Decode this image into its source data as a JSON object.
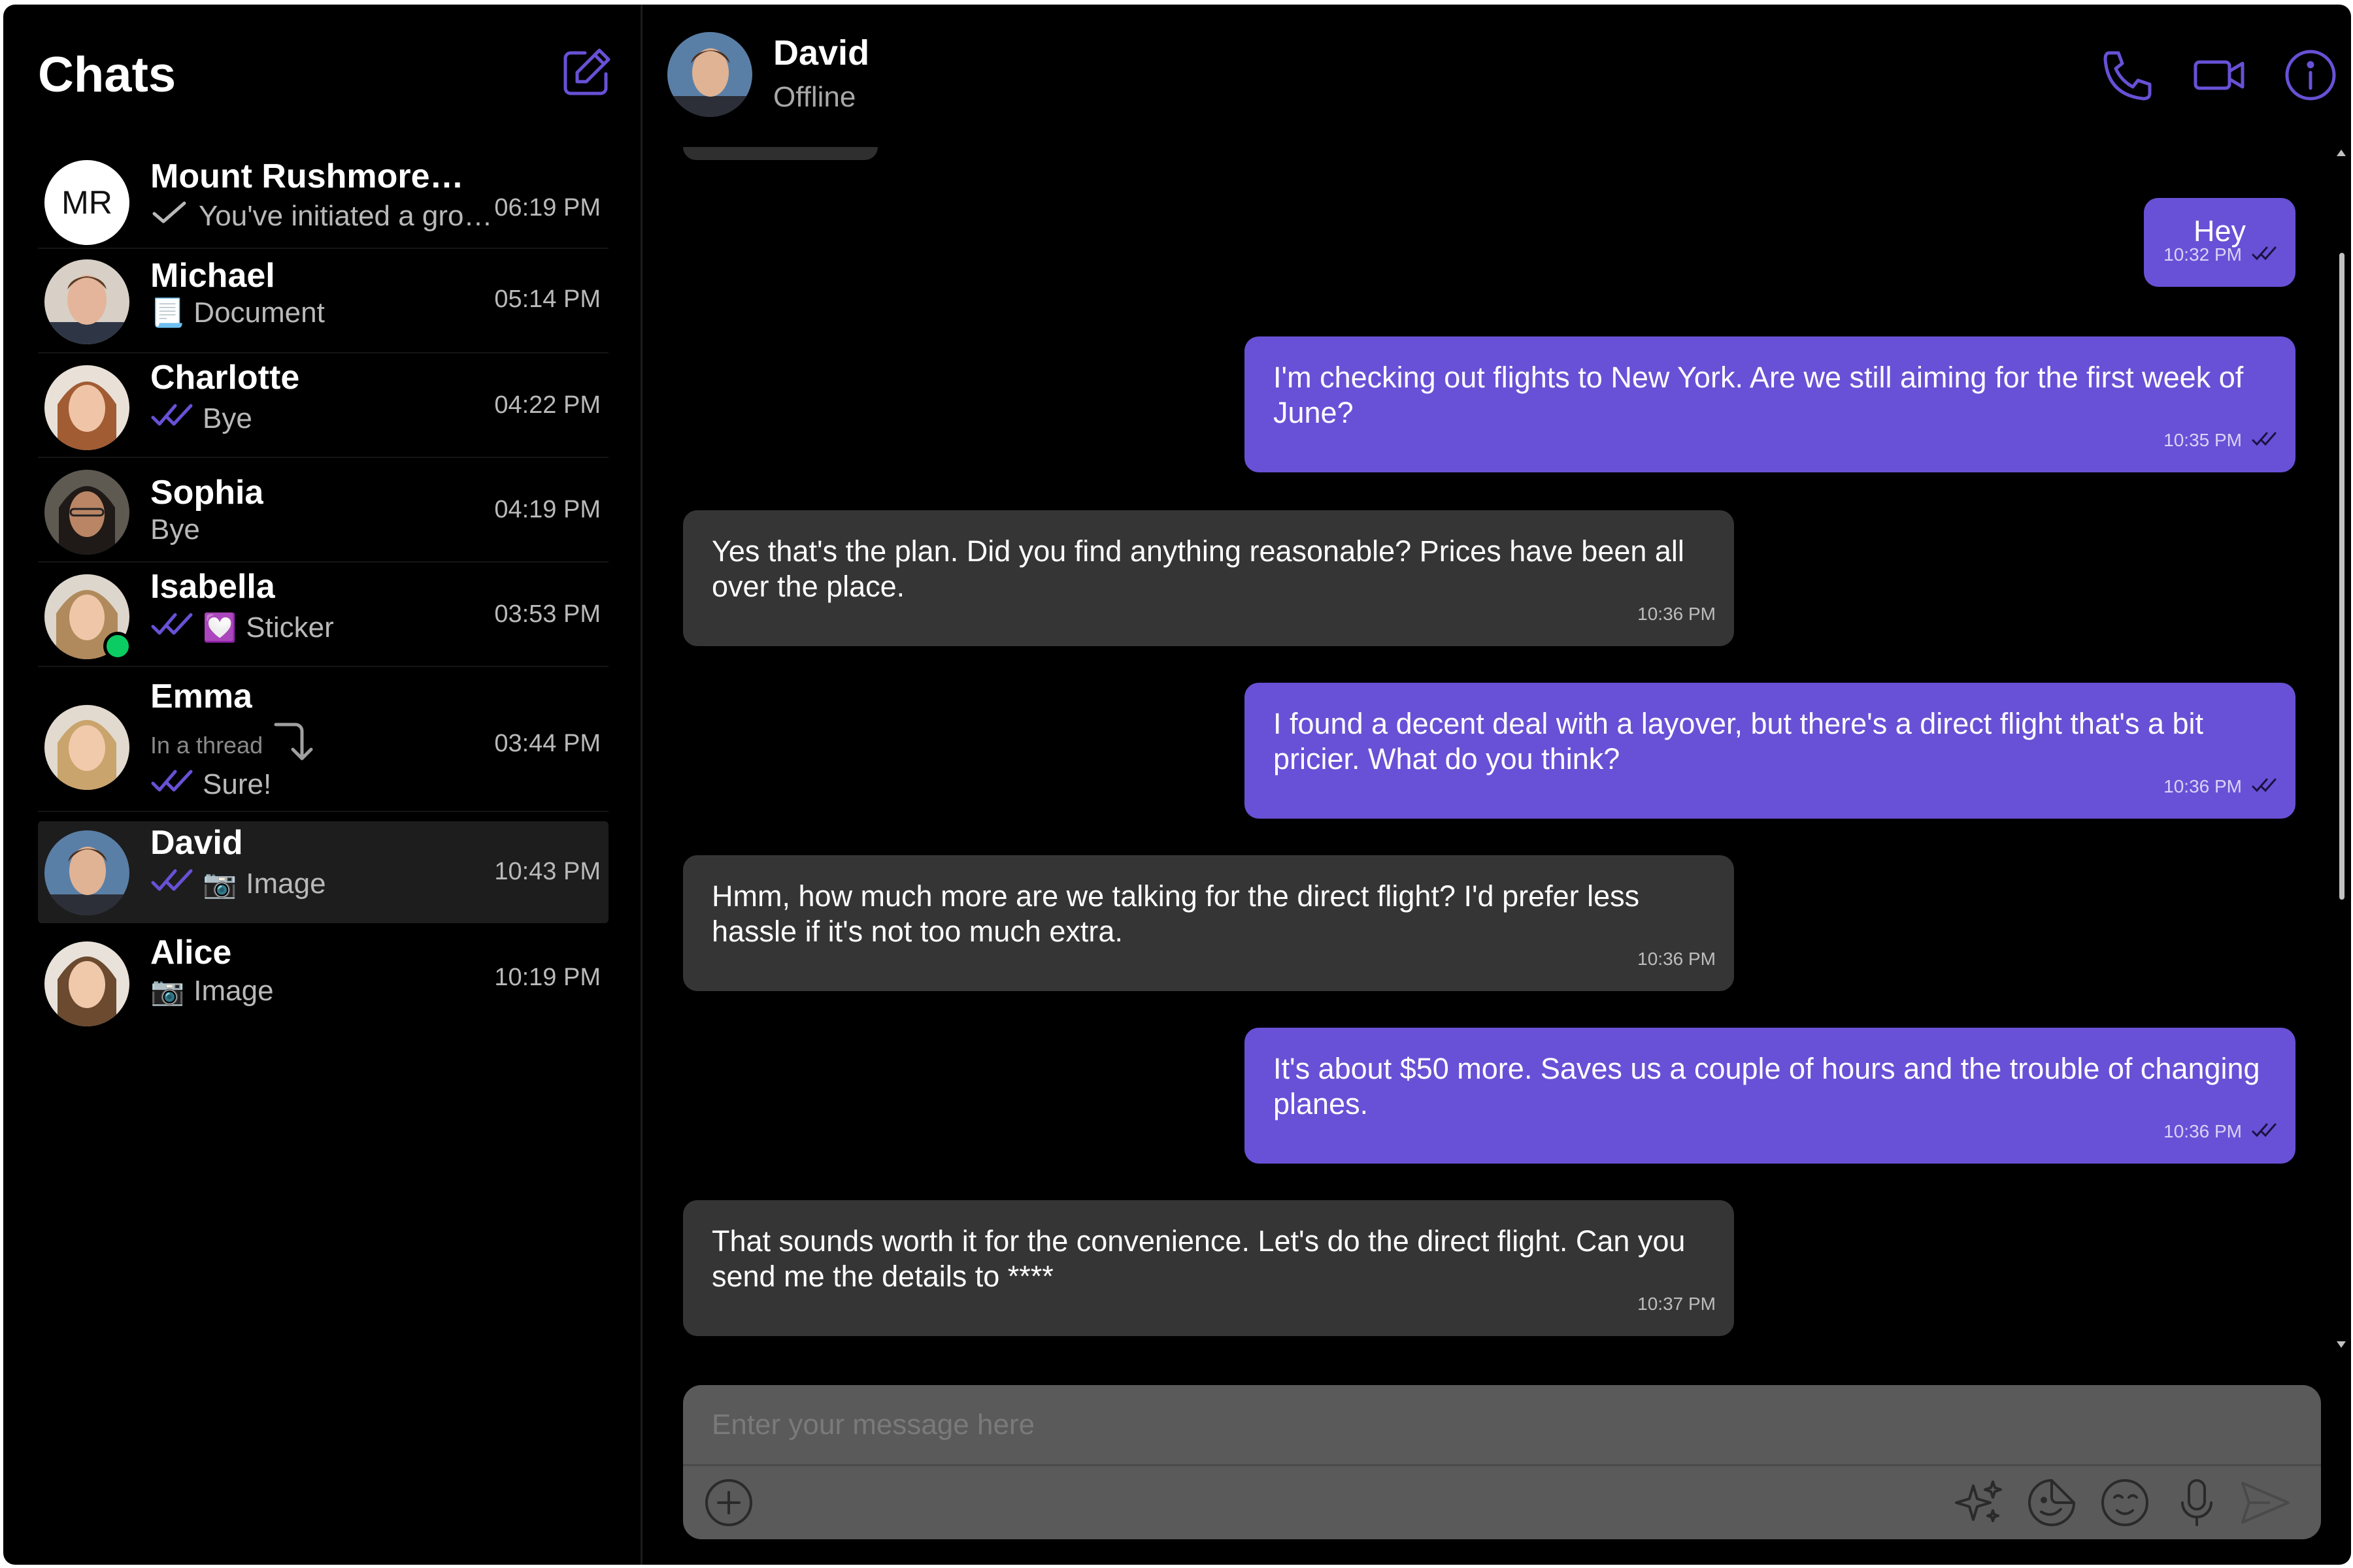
{
  "sidebar": {
    "title": "Chats",
    "chats": [
      {
        "name": "Mount Rushmore…",
        "initials": "MR",
        "preview": "You've initiated a gro…",
        "time": "06:19 PM"
      },
      {
        "name": "Michael",
        "preview": "Document",
        "time": "05:14 PM"
      },
      {
        "name": "Charlotte",
        "preview": "Bye",
        "time": "04:22 PM"
      },
      {
        "name": "Sophia",
        "preview": "Bye",
        "time": "04:19 PM"
      },
      {
        "name": "Isabella",
        "preview": "Sticker",
        "time": "03:53 PM"
      },
      {
        "name": "Emma",
        "thread": "In a thread",
        "preview": "Sure!",
        "time": "03:44 PM"
      },
      {
        "name": "David",
        "preview": "Image",
        "time": "10:43 PM"
      },
      {
        "name": "Alice",
        "preview": "Image",
        "time": "10:19 PM"
      }
    ]
  },
  "header": {
    "name": "David",
    "status": "Offline"
  },
  "messages": [
    {
      "dir": "out",
      "text": "Hey",
      "time": "10:32 PM"
    },
    {
      "dir": "out",
      "text": "I'm checking out flights to New York. Are we still aiming for the first week of June?",
      "time": "10:35 PM"
    },
    {
      "dir": "in",
      "text": "Yes that's the plan. Did you find anything reasonable? Prices have been all over the place.",
      "time": "10:36 PM"
    },
    {
      "dir": "out",
      "text": "I found a decent deal with a layover, but there's a direct flight that's a bit pricier. What do you think?",
      "time": "10:36 PM"
    },
    {
      "dir": "in",
      "text": "Hmm, how much more are we talking for the direct flight? I'd prefer less hassle if it's not too much extra.",
      "time": "10:36 PM"
    },
    {
      "dir": "out",
      "text": "It's about $50 more. Saves us a couple of hours and the trouble of changing planes.",
      "time": "10:36 PM"
    },
    {
      "dir": "in",
      "text": "That sounds worth it for the convenience. Let's do the direct flight. Can you send me the details to ****",
      "time": "10:37 PM"
    }
  ],
  "composer": {
    "placeholder": "Enter your message here"
  },
  "colors": {
    "accent": "#6851d6",
    "background": "#000000",
    "incoming_bubble": "#353535",
    "online": "#0bcc63"
  },
  "icons": {
    "compose": "compose-icon",
    "call": "phone-icon",
    "video": "video-icon",
    "info": "info-icon",
    "attach": "plus-circle-icon",
    "ai": "sparkle-icon",
    "sticker": "sticker-icon",
    "emoji": "emoji-icon",
    "mic": "microphone-icon",
    "send": "send-icon"
  }
}
